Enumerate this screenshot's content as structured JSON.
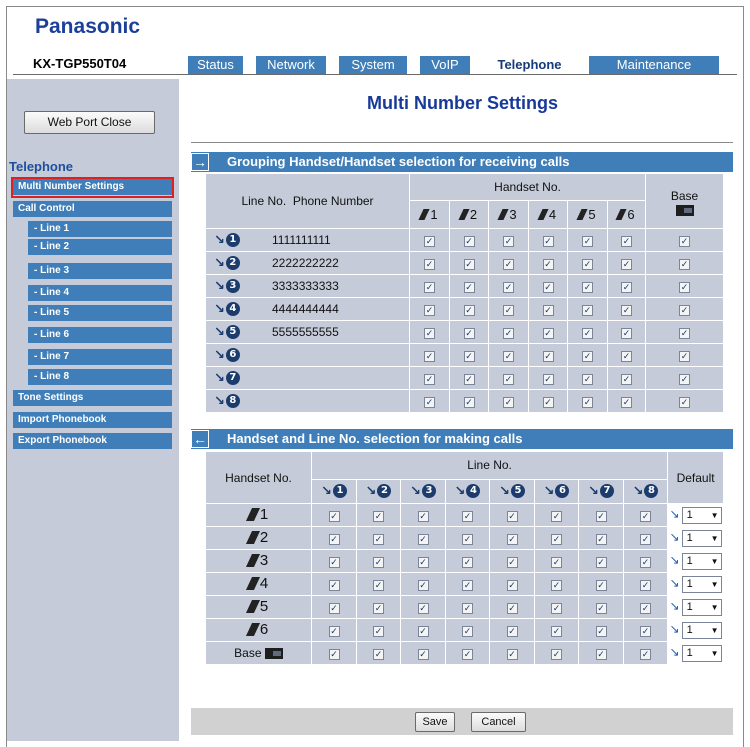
{
  "brand": "Panasonic",
  "model": "KX-TGP550T04",
  "tabs": [
    {
      "label": "Status",
      "active": false
    },
    {
      "label": "Network",
      "active": false
    },
    {
      "label": "System",
      "active": false
    },
    {
      "label": "VoIP",
      "active": false
    },
    {
      "label": "Telephone",
      "active": true
    },
    {
      "label": "Maintenance",
      "active": false
    }
  ],
  "sidebar": {
    "web_port_close": "Web Port Close",
    "heading": "Telephone",
    "items": [
      {
        "label": "Multi Number Settings",
        "selected": true
      },
      {
        "label": "Call Control"
      },
      {
        "label": "- Line 1"
      },
      {
        "label": "- Line 2"
      },
      {
        "label": "- Line 3"
      },
      {
        "label": "- Line 4"
      },
      {
        "label": "- Line 5"
      },
      {
        "label": "- Line 6"
      },
      {
        "label": "- Line 7"
      },
      {
        "label": "- Line 8"
      },
      {
        "label": "Tone Settings"
      },
      {
        "label": "Import Phonebook"
      },
      {
        "label": "Export Phonebook"
      }
    ]
  },
  "page_title": "Multi Number Settings",
  "receiving": {
    "title": "Grouping Handset/Handset selection for receiving calls",
    "col_line_no": "Line No.",
    "col_phone_number": "Phone Number",
    "col_handset_no": "Handset No.",
    "col_base": "Base",
    "handsets": [
      "1",
      "2",
      "3",
      "4",
      "5",
      "6"
    ],
    "rows": [
      {
        "line": "1",
        "phone": "1111111111",
        "checks": [
          true,
          true,
          true,
          true,
          true,
          true,
          true
        ]
      },
      {
        "line": "2",
        "phone": "2222222222",
        "checks": [
          true,
          true,
          true,
          true,
          true,
          true,
          true
        ]
      },
      {
        "line": "3",
        "phone": "3333333333",
        "checks": [
          true,
          true,
          true,
          true,
          true,
          true,
          true
        ]
      },
      {
        "line": "4",
        "phone": "4444444444",
        "checks": [
          true,
          true,
          true,
          true,
          true,
          true,
          true
        ]
      },
      {
        "line": "5",
        "phone": "5555555555",
        "checks": [
          true,
          true,
          true,
          true,
          true,
          true,
          true
        ]
      },
      {
        "line": "6",
        "phone": "",
        "checks": [
          true,
          true,
          true,
          true,
          true,
          true,
          true
        ]
      },
      {
        "line": "7",
        "phone": "",
        "checks": [
          true,
          true,
          true,
          true,
          true,
          true,
          true
        ]
      },
      {
        "line": "8",
        "phone": "",
        "checks": [
          true,
          true,
          true,
          true,
          true,
          true,
          true
        ]
      }
    ]
  },
  "making": {
    "title": "Handset and Line No. selection for making calls",
    "col_handset_no": "Handset No.",
    "col_line_no": "Line No.",
    "col_default": "Default",
    "lines": [
      "1",
      "2",
      "3",
      "4",
      "5",
      "6",
      "7",
      "8"
    ],
    "rows": [
      {
        "handset": "1",
        "checks": [
          true,
          true,
          true,
          true,
          true,
          true,
          true,
          true
        ],
        "default": "1"
      },
      {
        "handset": "2",
        "checks": [
          true,
          true,
          true,
          true,
          true,
          true,
          true,
          true
        ],
        "default": "1"
      },
      {
        "handset": "3",
        "checks": [
          true,
          true,
          true,
          true,
          true,
          true,
          true,
          true
        ],
        "default": "1"
      },
      {
        "handset": "4",
        "checks": [
          true,
          true,
          true,
          true,
          true,
          true,
          true,
          true
        ],
        "default": "1"
      },
      {
        "handset": "5",
        "checks": [
          true,
          true,
          true,
          true,
          true,
          true,
          true,
          true
        ],
        "default": "1"
      },
      {
        "handset": "6",
        "checks": [
          true,
          true,
          true,
          true,
          true,
          true,
          true,
          true
        ],
        "default": "1"
      },
      {
        "handset": "Base",
        "is_base": true,
        "checks": [
          true,
          true,
          true,
          true,
          true,
          true,
          true,
          true
        ],
        "default": "1"
      }
    ]
  },
  "buttons": {
    "save": "Save",
    "cancel": "Cancel"
  },
  "icons": {
    "right_arrow": "right-arrow-icon",
    "left_arrow": "left-arrow-icon",
    "line": "phone-line-icon",
    "handset": "handset-icon",
    "base": "base-unit-icon"
  },
  "colors": {
    "brand": "#1c3f9a",
    "tab_bg": "#3f7eb8",
    "grid_bg": "#c5cbd8",
    "highlight": "#e02020"
  }
}
